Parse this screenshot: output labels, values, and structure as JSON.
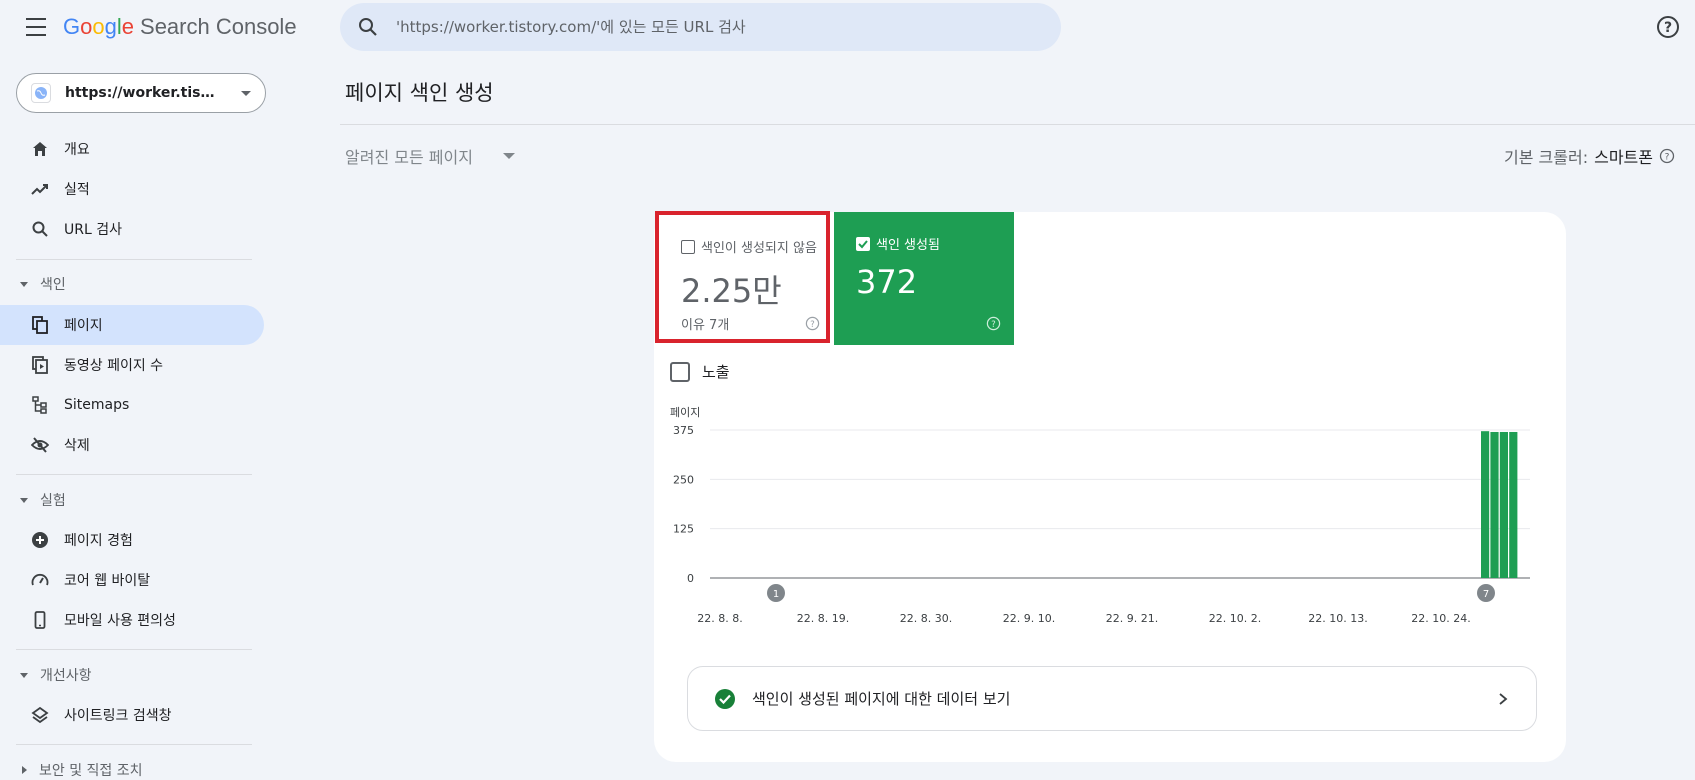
{
  "app": {
    "logo_google": [
      "G",
      "o",
      "o",
      "g",
      "l",
      "e"
    ],
    "logo_product": "Search Console"
  },
  "search": {
    "placeholder": "'https://worker.tistory.com/'에 있는 모든 URL 검사"
  },
  "property": {
    "label": "https://worker.tistory.com/"
  },
  "sidebar": {
    "items": [
      {
        "label": "개요",
        "icon": "home-icon"
      },
      {
        "label": "실적",
        "icon": "trending-icon"
      },
      {
        "label": "URL 검사",
        "icon": "search-icon"
      }
    ],
    "sections": [
      {
        "label": "색인",
        "items": [
          {
            "label": "페이지",
            "icon": "pages-icon",
            "active": true
          },
          {
            "label": "동영상 페이지 수",
            "icon": "video-pages-icon"
          },
          {
            "label": "Sitemaps",
            "icon": "sitemap-icon"
          },
          {
            "label": "삭제",
            "icon": "eye-off-icon"
          }
        ]
      },
      {
        "label": "실험",
        "items": [
          {
            "label": "페이지 경험",
            "icon": "plus-circle-icon"
          },
          {
            "label": "코어 웹 바이탈",
            "icon": "gauge-icon"
          },
          {
            "label": "모바일 사용 편의성",
            "icon": "phone-icon"
          }
        ]
      },
      {
        "label": "개선사항",
        "items": [
          {
            "label": "사이트링크 검색창",
            "icon": "layers-icon"
          }
        ]
      },
      {
        "label": "보안 및 직접 조치",
        "items": []
      }
    ]
  },
  "main": {
    "title": "페이지 색인 생성",
    "filter_label": "알려진 모든 페이지",
    "crawler_label": "기본 크롤러:",
    "crawler_value": "스마트폰",
    "tiles": {
      "not_indexed": {
        "label": "색인이 생성되지 않음",
        "value": "2.25만",
        "sub": "이유 7개",
        "checked": false
      },
      "indexed": {
        "label": "색인 생성됨",
        "value": "372",
        "checked": true,
        "color": "#1e9e53"
      }
    },
    "impressions_label": "노출",
    "cta_label": "색인이 생성된 페이지에 대한 데이터 보기"
  },
  "chart_data": {
    "type": "bar",
    "ylabel": "페이지",
    "ylim": [
      0,
      375
    ],
    "yticks": [
      0,
      125,
      250,
      375
    ],
    "x_tick_labels": [
      "22. 8. 8.",
      "22. 8. 19.",
      "22. 8. 30.",
      "22. 9. 10.",
      "22. 9. 21.",
      "22. 10. 2.",
      "22. 10. 13.",
      "22. 10. 24."
    ],
    "x": [
      "22. 10. 31.",
      "22. 11. 1.",
      "22. 11. 2.",
      "22. 11. 3."
    ],
    "series": [
      {
        "values": [
          372,
          370,
          370,
          370
        ],
        "color": "#1e9e53"
      }
    ],
    "annotations": [
      "1",
      "7"
    ],
    "grid": true
  }
}
